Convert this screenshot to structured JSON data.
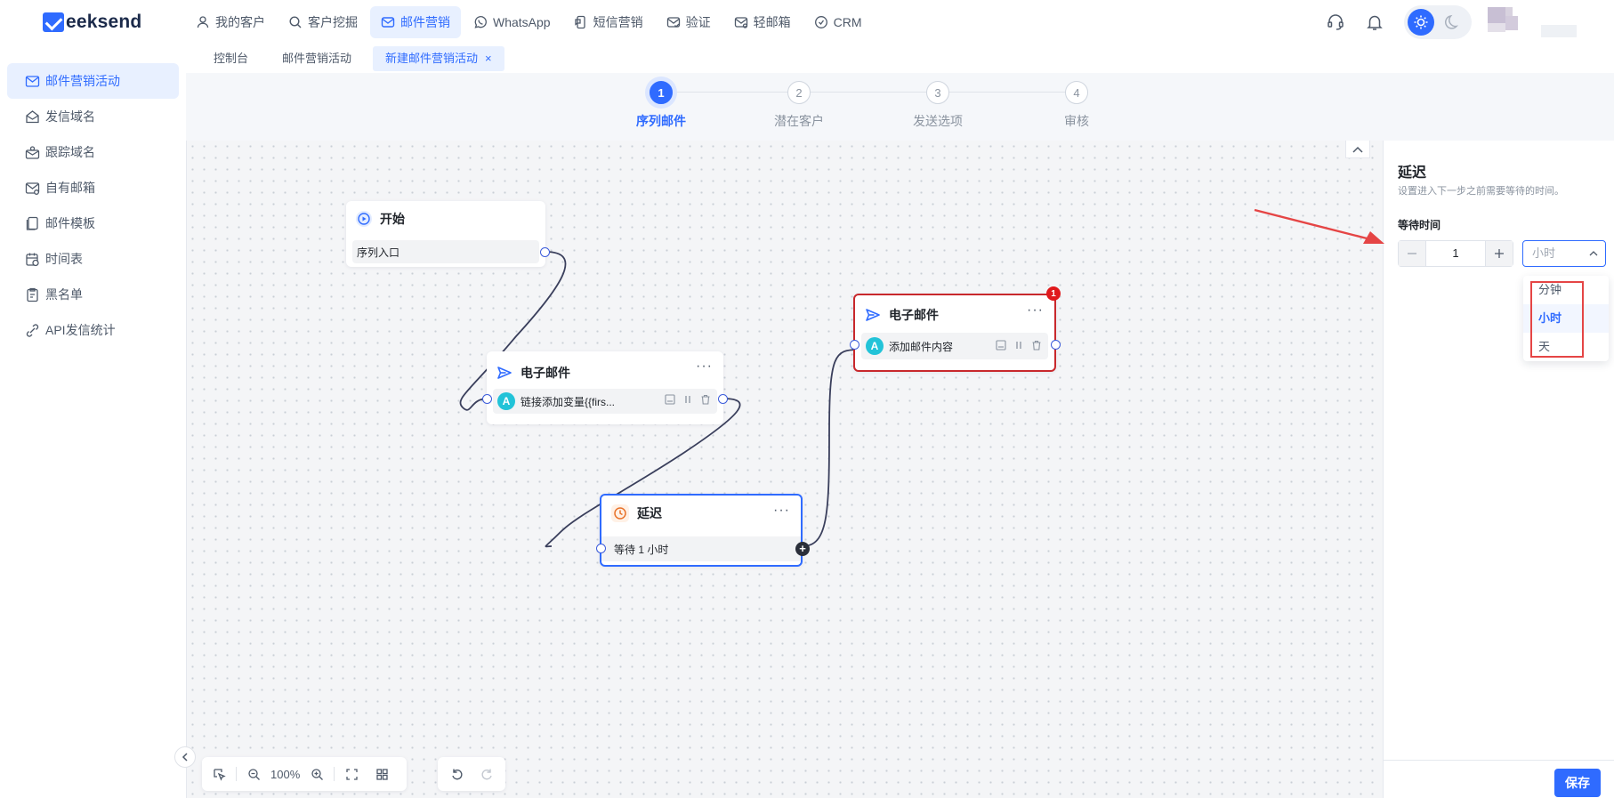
{
  "brand": {
    "logo_text": "eeksend",
    "accent": "#2f6bff"
  },
  "nav": {
    "items": [
      {
        "label": "我的客户",
        "icon": "user-icon"
      },
      {
        "label": "客户挖掘",
        "icon": "search-icon"
      },
      {
        "label": "邮件营销",
        "icon": "mail-icon",
        "active": true
      },
      {
        "label": "WhatsApp",
        "icon": "whatsapp-icon"
      },
      {
        "label": "短信营销",
        "icon": "sms-icon"
      },
      {
        "label": "验证",
        "icon": "verify-icon"
      },
      {
        "label": "轻邮箱",
        "icon": "mailbox-icon"
      },
      {
        "label": "CRM",
        "icon": "crm-icon"
      }
    ]
  },
  "tabs": [
    {
      "label": "控制台"
    },
    {
      "label": "邮件营销活动"
    },
    {
      "label": "新建邮件营销活动",
      "active": true,
      "close": "×"
    }
  ],
  "sidebar": {
    "items": [
      {
        "label": "邮件营销活动",
        "icon": "campaign-icon",
        "active": true
      },
      {
        "label": "发信域名",
        "icon": "domain-icon"
      },
      {
        "label": "跟踪域名",
        "icon": "tracking-icon"
      },
      {
        "label": "自有邮箱",
        "icon": "own-mailbox-icon"
      },
      {
        "label": "邮件模板",
        "icon": "template-icon"
      },
      {
        "label": "时间表",
        "icon": "schedule-icon"
      },
      {
        "label": "黑名单",
        "icon": "blacklist-icon"
      },
      {
        "label": "API发信统计",
        "icon": "api-icon"
      }
    ]
  },
  "steps": [
    {
      "num": "1",
      "label": "序列邮件",
      "active": true
    },
    {
      "num": "2",
      "label": "潜在客户"
    },
    {
      "num": "3",
      "label": "发送选项"
    },
    {
      "num": "4",
      "label": "审核"
    }
  ],
  "canvas": {
    "start_node": {
      "title": "开始",
      "row": "序列入口"
    },
    "email_node_1": {
      "title": "电子邮件",
      "row": "链接添加变量{{firs...",
      "badge": "A",
      "more": "···"
    },
    "delay_node": {
      "title": "延迟",
      "row": "等待 1 小时",
      "more": "···",
      "plus": "+"
    },
    "email_node_2": {
      "title": "电子邮件",
      "row": "添加邮件内容",
      "badge": "A",
      "more": "···",
      "error_count": "1"
    },
    "toolbar": {
      "zoom": "100%"
    }
  },
  "panel": {
    "title": "延迟",
    "description": "设置进入下一步之前需要等待的时间。",
    "wait_label": "等待时间",
    "wait_value": "1",
    "unit_selected": "小时",
    "unit_options": [
      "分钟",
      "小时",
      "天"
    ],
    "save_label": "保存"
  }
}
